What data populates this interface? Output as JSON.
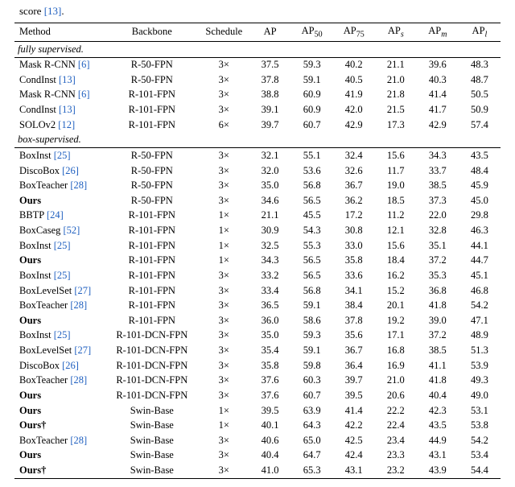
{
  "caption": {
    "line1": "score ",
    "ref": "13",
    "period": "."
  },
  "table": {
    "columns": [
      "Method",
      "Backbone",
      "Schedule",
      "AP",
      "AP50",
      "AP75",
      "APs",
      "APm",
      "APl"
    ],
    "sections": [
      {
        "title": "fully supervised.",
        "rows": [
          {
            "method": "Mask R-CNN",
            "ref": "6",
            "backbone": "R-50-FPN",
            "schedule": "3×",
            "ap": "37.5",
            "ap50": "59.3",
            "ap75": "40.2",
            "aps": "21.1",
            "apm": "39.6",
            "apl": "48.3"
          },
          {
            "method": "CondInst",
            "ref": "13",
            "backbone": "R-50-FPN",
            "schedule": "3×",
            "ap": "37.8",
            "ap50": "59.1",
            "ap75": "40.5",
            "aps": "21.0",
            "apm": "40.3",
            "apl": "48.7"
          },
          {
            "method": "Mask R-CNN",
            "ref": "6",
            "backbone": "R-101-FPN",
            "schedule": "3×",
            "ap": "38.8",
            "ap50": "60.9",
            "ap75": "41.9",
            "aps": "21.8",
            "apm": "41.4",
            "apl": "50.5"
          },
          {
            "method": "CondInst",
            "ref": "13",
            "backbone": "R-101-FPN",
            "schedule": "3×",
            "ap": "39.1",
            "ap50": "60.9",
            "ap75": "42.0",
            "aps": "21.5",
            "apm": "41.7",
            "apl": "50.9"
          },
          {
            "method": "SOLOv2",
            "ref": "12",
            "backbone": "R-101-FPN",
            "schedule": "6×",
            "ap": "39.7",
            "ap50": "60.7",
            "ap75": "42.9",
            "aps": "17.3",
            "apm": "42.9",
            "apl": "57.4"
          }
        ]
      },
      {
        "title": "box-supervised.",
        "rows": [
          {
            "method": "BoxInst",
            "ref": "25",
            "backbone": "R-50-FPN",
            "schedule": "3×",
            "ap": "32.1",
            "ap50": "55.1",
            "ap75": "32.4",
            "aps": "15.6",
            "apm": "34.3",
            "apl": "43.5"
          },
          {
            "method": "DiscoBox",
            "ref": "26",
            "backbone": "R-50-FPN",
            "schedule": "3×",
            "ap": "32.0",
            "ap50": "53.6",
            "ap75": "32.6",
            "aps": "11.7",
            "apm": "33.7",
            "apl": "48.4"
          },
          {
            "method": "BoxTeacher",
            "ref": "28",
            "backbone": "R-50-FPN",
            "schedule": "3×",
            "ap": "35.0",
            "ap50": "56.8",
            "ap75": "36.7",
            "aps": "19.0",
            "apm": "38.5",
            "apl": "45.9"
          },
          {
            "method": "Ours",
            "bold": true,
            "backbone": "R-50-FPN",
            "schedule": "3×",
            "ap": "34.6",
            "ap50": "56.5",
            "ap75": "36.2",
            "aps": "18.5",
            "apm": "37.3",
            "apl": "45.0"
          },
          {
            "method": "BBTP",
            "ref": "24",
            "backbone": "R-101-FPN",
            "schedule": "1×",
            "ap": "21.1",
            "ap50": "45.5",
            "ap75": "17.2",
            "aps": "11.2",
            "apm": "22.0",
            "apl": "29.8"
          },
          {
            "method": "BoxCaseg",
            "ref": "52",
            "backbone": "R-101-FPN",
            "schedule": "1×",
            "ap": "30.9",
            "ap50": "54.3",
            "ap75": "30.8",
            "aps": "12.1",
            "apm": "32.8",
            "apl": "46.3"
          },
          {
            "method": "BoxInst",
            "ref": "25",
            "backbone": "R-101-FPN",
            "schedule": "1×",
            "ap": "32.5",
            "ap50": "55.3",
            "ap75": "33.0",
            "aps": "15.6",
            "apm": "35.1",
            "apl": "44.1"
          },
          {
            "method": "Ours",
            "bold": true,
            "backbone": "R-101-FPN",
            "schedule": "1×",
            "ap": "34.3",
            "ap50": "56.5",
            "ap75": "35.8",
            "aps": "18.4",
            "apm": "37.2",
            "apl": "44.7"
          },
          {
            "method": "BoxInst",
            "ref": "25",
            "backbone": "R-101-FPN",
            "schedule": "3×",
            "ap": "33.2",
            "ap50": "56.5",
            "ap75": "33.6",
            "aps": "16.2",
            "apm": "35.3",
            "apl": "45.1"
          },
          {
            "method": "BoxLevelSet",
            "ref": "27",
            "backbone": "R-101-FPN",
            "schedule": "3×",
            "ap": "33.4",
            "ap50": "56.8",
            "ap75": "34.1",
            "aps": "15.2",
            "apm": "36.8",
            "apl": "46.8"
          },
          {
            "method": "BoxTeacher",
            "ref": "28",
            "backbone": "R-101-FPN",
            "schedule": "3×",
            "ap": "36.5",
            "ap50": "59.1",
            "ap75": "38.4",
            "aps": "20.1",
            "apm": "41.8",
            "apl": "54.2"
          },
          {
            "method": "Ours",
            "bold": true,
            "backbone": "R-101-FPN",
            "schedule": "3×",
            "ap": "36.0",
            "ap50": "58.6",
            "ap75": "37.8",
            "aps": "19.2",
            "apm": "39.0",
            "apl": "47.1"
          },
          {
            "method": "BoxInst",
            "ref": "25",
            "backbone": "R-101-DCN-FPN",
            "schedule": "3×",
            "ap": "35.0",
            "ap50": "59.3",
            "ap75": "35.6",
            "aps": "17.1",
            "apm": "37.2",
            "apl": "48.9"
          },
          {
            "method": "BoxLevelSet",
            "ref": "27",
            "backbone": "R-101-DCN-FPN",
            "schedule": "3×",
            "ap": "35.4",
            "ap50": "59.1",
            "ap75": "36.7",
            "aps": "16.8",
            "apm": "38.5",
            "apl": "51.3"
          },
          {
            "method": "DiscoBox",
            "ref": "26",
            "backbone": "R-101-DCN-FPN",
            "schedule": "3×",
            "ap": "35.8",
            "ap50": "59.8",
            "ap75": "36.4",
            "aps": "16.9",
            "apm": "41.1",
            "apl": "53.9"
          },
          {
            "method": "BoxTeacher",
            "ref": "28",
            "backbone": "R-101-DCN-FPN",
            "schedule": "3×",
            "ap": "37.6",
            "ap50": "60.3",
            "ap75": "39.7",
            "aps": "21.0",
            "apm": "41.8",
            "apl": "49.3"
          },
          {
            "method": "Ours",
            "bold": true,
            "backbone": "R-101-DCN-FPN",
            "schedule": "3×",
            "ap": "37.6",
            "ap50": "60.7",
            "ap75": "39.5",
            "aps": "20.6",
            "apm": "40.4",
            "apl": "49.0"
          },
          {
            "method": "Ours",
            "bold": true,
            "backbone": "Swin-Base",
            "schedule": "1×",
            "ap": "39.5",
            "ap50": "63.9",
            "ap75": "41.4",
            "aps": "22.2",
            "apm": "42.3",
            "apl": "53.1"
          },
          {
            "method": "Ours†",
            "bold": true,
            "backbone": "Swin-Base",
            "schedule": "1×",
            "ap": "40.1",
            "ap50": "64.3",
            "ap75": "42.2",
            "aps": "22.4",
            "apm": "43.5",
            "apl": "53.8"
          },
          {
            "method": "BoxTeacher",
            "ref": "28",
            "backbone": "Swin-Base",
            "schedule": "3×",
            "ap": "40.6",
            "ap50": "65.0",
            "ap75": "42.5",
            "aps": "23.4",
            "apm": "44.9",
            "apl": "54.2"
          },
          {
            "method": "Ours",
            "bold": true,
            "backbone": "Swin-Base",
            "schedule": "3×",
            "ap": "40.4",
            "ap50": "64.7",
            "ap75": "42.4",
            "aps": "23.3",
            "apm": "43.1",
            "apl": "53.4"
          },
          {
            "method": "Ours†",
            "bold": true,
            "backbone": "Swin-Base",
            "schedule": "3×",
            "ap": "41.0",
            "ap50": "65.3",
            "ap75": "43.1",
            "aps": "23.2",
            "apm": "43.9",
            "apl": "54.4"
          }
        ]
      }
    ]
  }
}
